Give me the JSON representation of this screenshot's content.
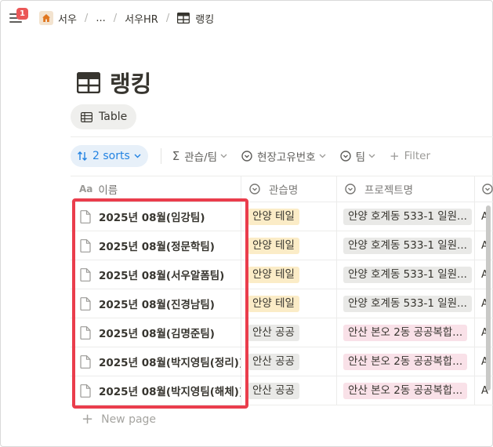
{
  "topbar": {
    "notification_count": "1",
    "breadcrumbs": [
      "서우",
      "...",
      "서우HR",
      "랭킹"
    ]
  },
  "page": {
    "title": "랭킹"
  },
  "view_tab": {
    "label": "Table"
  },
  "toolbar": {
    "sorts_label": "2 sorts",
    "filters": [
      "관습/팀",
      "현장고유번호",
      "팀"
    ],
    "add_filter": "Filter"
  },
  "columns": [
    {
      "label": "이름",
      "icon": "Aa-title-icon"
    },
    {
      "label": "관습명",
      "icon": "select-icon"
    },
    {
      "label": "프로젝트명",
      "icon": "select-icon"
    }
  ],
  "rows": [
    {
      "name": "2025년 08월(임강팀)",
      "group": "안양 테일",
      "group_color": "yellow",
      "project": "안양 호계동 533-1 일원...",
      "project_color": "gray",
      "last": "A"
    },
    {
      "name": "2025년 08월(정문학팀)",
      "group": "안양 테일",
      "group_color": "yellow",
      "project": "안양 호계동 533-1 일원...",
      "project_color": "gray",
      "last": "A"
    },
    {
      "name": "2025년 08월(서우알폼팀)",
      "group": "안양 테일",
      "group_color": "yellow",
      "project": "안양 호계동 533-1 일원...",
      "project_color": "gray",
      "last": "A"
    },
    {
      "name": "2025년 08월(진경남팀)",
      "group": "안양 테일",
      "group_color": "yellow",
      "project": "안양 호계동 533-1 일원...",
      "project_color": "gray",
      "last": "A"
    },
    {
      "name": "2025년 08월(김명준팀)",
      "group": "안산 공공",
      "group_color": "gray",
      "project": "안산 본오 2동 공공복합...",
      "project_color": "pink",
      "last": "A"
    },
    {
      "name": "2025년 08월(박지영팀(정리))",
      "group": "안산 공공",
      "group_color": "gray",
      "project": "안산 본오 2동 공공복합...",
      "project_color": "pink",
      "last": "A"
    },
    {
      "name": "2025년 08월(박지영팀(해체))",
      "group": "안산 공공",
      "group_color": "gray",
      "project": "안산 본오 2동 공공복합...",
      "project_color": "pink",
      "last": "A"
    }
  ],
  "new_page_label": "New page",
  "colors": {
    "accent": "#2383e2",
    "highlight": "#ea3d4c",
    "badge": "#eb5757"
  }
}
